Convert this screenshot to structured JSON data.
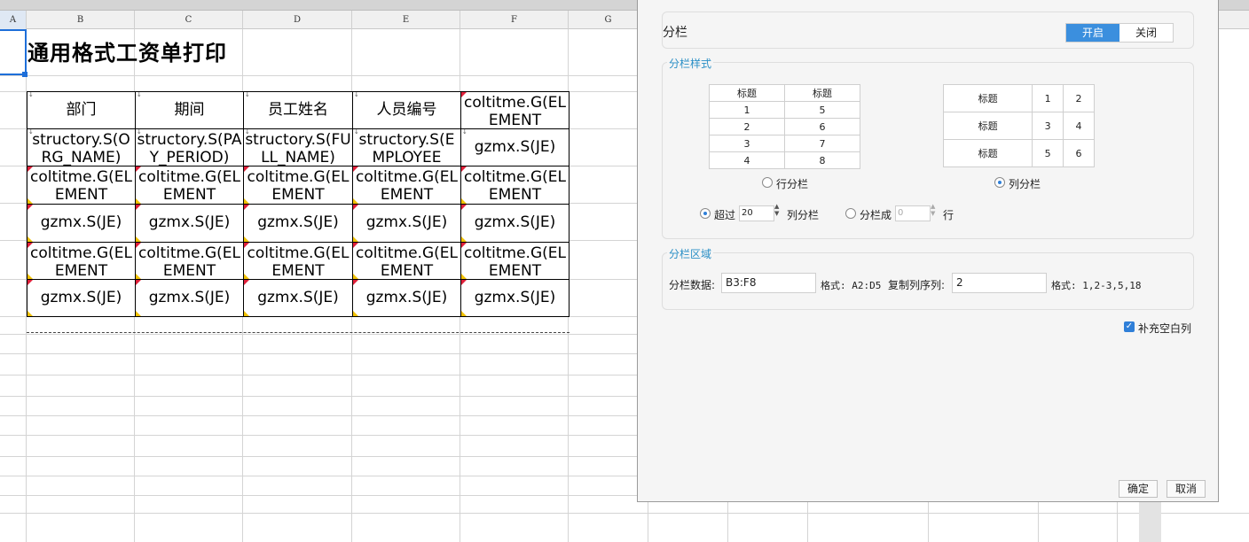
{
  "sheet": {
    "columns": [
      "A",
      "B",
      "C",
      "D",
      "E",
      "F",
      "G"
    ],
    "title": "通用格式工资单打印",
    "table": {
      "rows": [
        [
          "部门",
          "期间",
          "员工姓名",
          "人员编号",
          "coltitme.G(ELEMENT"
        ],
        [
          "structory.S(ORG_NAME)",
          "structory.S(PAY_PERIOD)",
          "structory.S(FULL_NAME)",
          "structory.S(EMPLOYEE",
          "gzmx.S(JE)"
        ],
        [
          "coltitme.G(ELEMENT",
          "coltitme.G(ELEMENT",
          "coltitme.G(ELEMENT",
          "coltitme.G(ELEMENT",
          "coltitme.G(ELEMENT"
        ],
        [
          "gzmx.S(JE)",
          "gzmx.S(JE)",
          "gzmx.S(JE)",
          "gzmx.S(JE)",
          "gzmx.S(JE)"
        ],
        [
          "coltitme.G(ELEMENT",
          "coltitme.G(ELEMENT",
          "coltitme.G(ELEMENT",
          "coltitme.G(ELEMENT",
          "coltitme.G(ELEMENT"
        ],
        [
          "gzmx.S(JE)",
          "gzmx.S(JE)",
          "gzmx.S(JE)",
          "gzmx.S(JE)",
          "gzmx.S(JE)"
        ]
      ]
    }
  },
  "dialog": {
    "section_title": "分栏",
    "toggle": {
      "on_label": "开启",
      "off_label": "关闭"
    },
    "style_group": {
      "label": "分栏样式",
      "row_preview": {
        "header": [
          "标题",
          "标题"
        ],
        "rows": [
          [
            "1",
            "5"
          ],
          [
            "2",
            "6"
          ],
          [
            "3",
            "7"
          ],
          [
            "4",
            "8"
          ]
        ]
      },
      "col_preview": {
        "rows": [
          [
            "标题",
            "1",
            "2"
          ],
          [
            "标题",
            "3",
            "4"
          ],
          [
            "标题",
            "5",
            "6"
          ]
        ]
      },
      "row_option": "行分栏",
      "col_option": "列分栏",
      "exceed_label": "超过",
      "exceed_value": "20",
      "exceed_suffix": "列分栏",
      "split_label": "分栏成",
      "split_value": "0",
      "split_suffix": "行"
    },
    "area_group": {
      "label": "分栏区域",
      "data_label": "分栏数据:",
      "data_value": "B3:F8",
      "data_format": "格式: A2:D5",
      "copy_label": "复制列序列:",
      "copy_value": "2",
      "copy_format": "格式: 1,2-3,5,18"
    },
    "fill_blank_label": "补充空白列",
    "ok_label": "确定",
    "cancel_label": "取消"
  }
}
